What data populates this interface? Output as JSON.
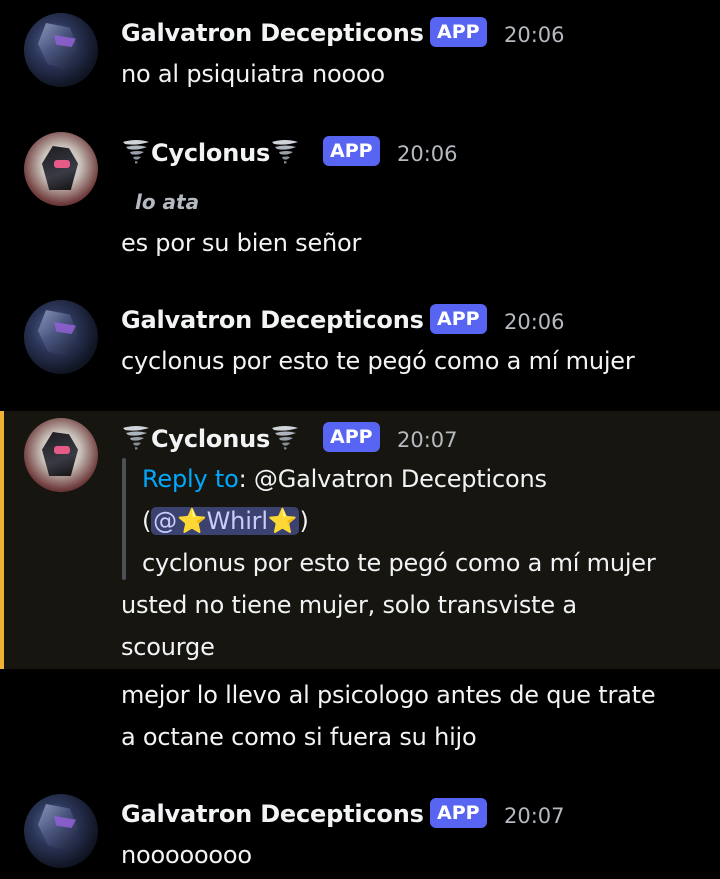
{
  "badge_label": "APP",
  "messages": [
    {
      "author": "Galvatron Decepticons",
      "time": "20:06",
      "text": "no al psiquiatra noooo"
    },
    {
      "author": "Cyclonus",
      "time": "20:06",
      "note": "lo ata",
      "text": "es por su bien señor"
    },
    {
      "author": "Galvatron Decepticons",
      "time": "20:06",
      "text": "cyclonus por esto te pegó como a mí mujer"
    },
    {
      "author": "Cyclonus",
      "time": "20:07",
      "reply_label": "Reply to",
      "reply_target": ": @Galvatron Decepticons",
      "reply_open": "(",
      "reply_mention": "@⭐Whirl⭐",
      "reply_close": ")",
      "quoted_text": "cyclonus por esto te pegó como a mí mujer",
      "text_line1": "usted no tiene mujer, solo transviste a",
      "text_line2": "scourge"
    },
    {
      "text_line1": "mejor lo llevo al psicologo antes de que trate",
      "text_line2": "a octane como si fuera su hijo"
    },
    {
      "author": "Galvatron Decepticons",
      "time": "20:07",
      "text": "noooooooo"
    }
  ],
  "colors": {
    "background": "#000000",
    "badge": "#5865f2",
    "highlight_bar": "#f0b232",
    "reply_link": "#00a8fc"
  }
}
